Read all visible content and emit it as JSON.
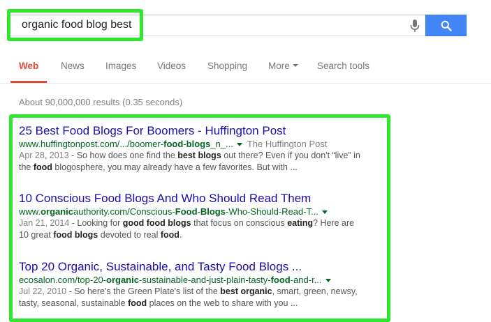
{
  "search": {
    "query": "organic food blog best"
  },
  "tabs": [
    {
      "label": "Web"
    },
    {
      "label": "News"
    },
    {
      "label": "Images"
    },
    {
      "label": "Videos"
    },
    {
      "label": "Shopping"
    },
    {
      "label": "More"
    },
    {
      "label": "Search tools"
    }
  ],
  "stats": "About 90,000,000 results (0.35 seconds)",
  "results": [
    {
      "title": "25 Best Food Blogs For Boomers - Huffington Post",
      "url_parts": [
        "www.huffingtonpost.com/.../boomer-",
        "food",
        "-",
        "blogs",
        "_n_..."
      ],
      "source": "The Huffington Post",
      "date": "Apr 28, 2013",
      "snippet_line1": [
        " - So how does one find the ",
        "best blogs",
        " out there? Even if you don't “live” in"
      ],
      "snippet_line2": [
        "the ",
        "food",
        " blogosphere, you may already have a few favorites. But with ..."
      ]
    },
    {
      "title": "10 Conscious Food Blogs And Who Should Read Them",
      "url_parts": [
        "www.",
        "organic",
        "authority.com/Conscious-",
        "Food",
        "-",
        "Blogs",
        "-Who-Should-Read-T..."
      ],
      "date": "Jan 21, 2014",
      "snippet_line1": [
        " - Looking for ",
        "good food blogs",
        " that focus on conscious ",
        "eating",
        "? Here are"
      ],
      "snippet_line2": [
        "10 great ",
        "food blogs",
        " devoted to real ",
        "food",
        "."
      ]
    },
    {
      "title": "Top 20 Organic, Sustainable, and Tasty Food Blogs ...",
      "url_parts": [
        "ecosalon.com/top-20-",
        "organic",
        "-sustainable-and-just-plain-tasty-",
        "food",
        "-and-r..."
      ],
      "date": "Jul 22, 2010",
      "snippet_line1": [
        " - So here's the Green Plate's list of the ",
        "best organic",
        ", smart, green, newsy,"
      ],
      "snippet_line2": [
        "tasty, seasonal, sustainable ",
        "food",
        " places on the web to share with you  ..."
      ]
    }
  ],
  "icons": {
    "mic": "microphone-icon",
    "search": "magnifier-icon"
  },
  "colors": {
    "highlight": "#2ee82e",
    "active_tab": "#dd4b39",
    "link": "#1a0dab",
    "url": "#006621",
    "button": "#4285f4"
  }
}
